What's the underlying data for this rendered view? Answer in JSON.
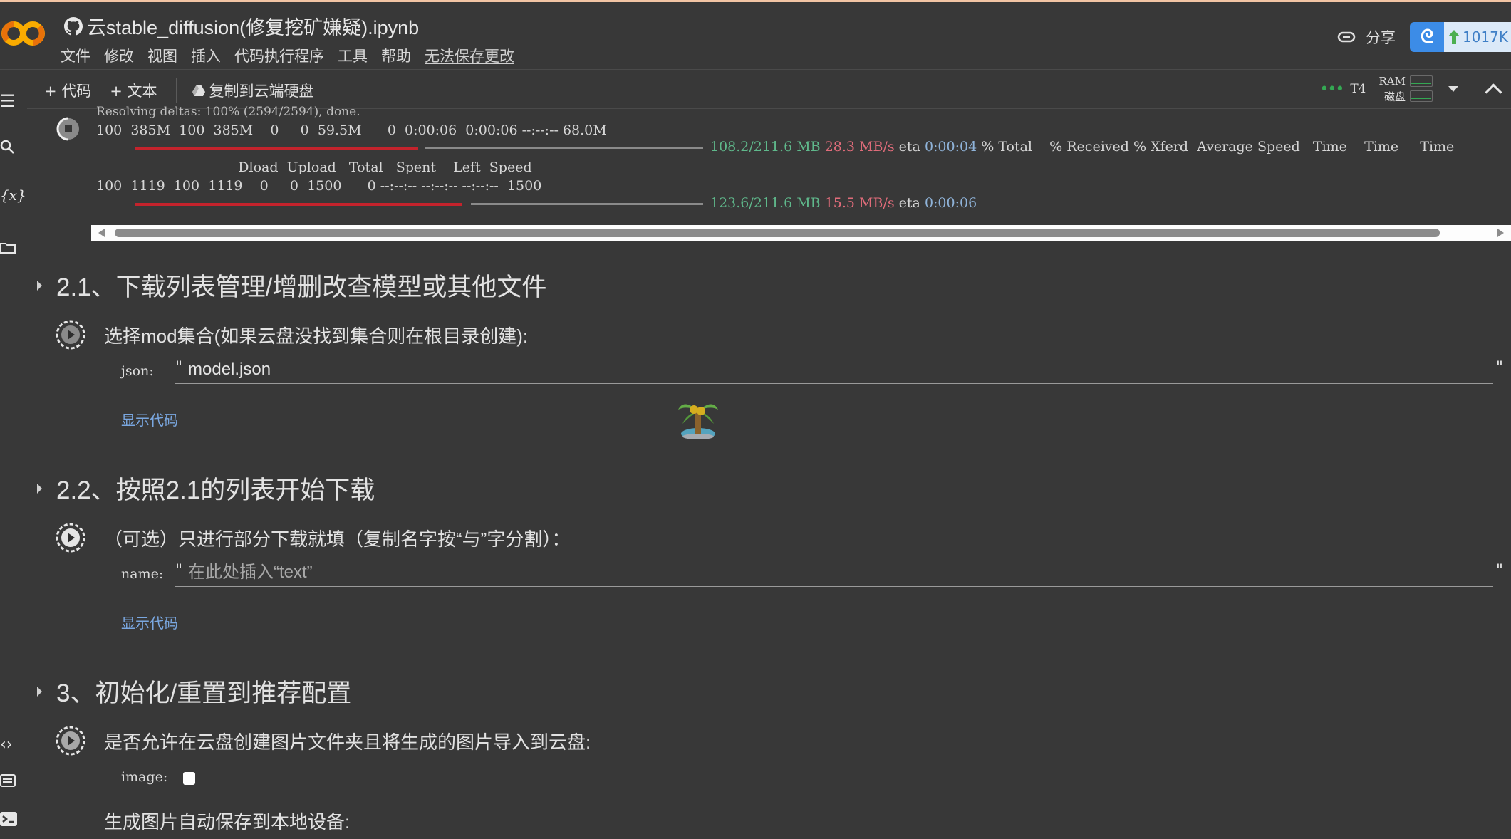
{
  "app": {
    "logo": "colab-logo",
    "title": "云stable_diffusion(修复挖矿嫌疑).ipynb",
    "title_icon": "github-icon"
  },
  "menu": [
    "文件",
    "修改",
    "视图",
    "插入",
    "代码执行程序",
    "工具",
    "帮助"
  ],
  "unsaved_label": "无法保存更改",
  "header_right": {
    "share_label": "分享",
    "share_icon": "link-icon",
    "extension_icon": "cloud-drive-icon",
    "upload_speed": "1017K"
  },
  "toolbar": {
    "add_code": "+ 代码",
    "add_text": "+ 文本",
    "copy_to_drive": "复制到云端硬盘",
    "runtime_name": "T4",
    "ram_label": "RAM",
    "disk_label": "磁盘"
  },
  "rail_icons": [
    "table-of-contents-icon",
    "search-icon",
    "variables-icon",
    "files-icon",
    "code-snippets-icon",
    "command-palette-icon",
    "terminal-icon"
  ],
  "output": {
    "line0": "Resolving deltas: 100% (2594/2594), done.",
    "line1": "100  385M  100  385M    0     0  59.5M      0  0:00:06  0:00:06 --:--:-- 68.0M",
    "progress1": {
      "size": "108.2/211.6 MB",
      "speed": "28.3 MB/s",
      "eta_label": "eta",
      "eta": "0:00:04",
      "trailing": "% Total    % Received % Xferd  Average Speed   Time    Time     Time",
      "fraction": 0.511
    },
    "line2": "                                 Dload  Upload   Total   Spent    Left  Speed",
    "line3": "100  1119  100  1119    0     0  1500      0 --:--:-- --:--:-- --:--:--  1500",
    "progress2": {
      "size": "123.6/211.6 MB",
      "speed": "15.5 MB/s",
      "eta_label": "eta",
      "eta": "0:00:06",
      "fraction": 0.584
    }
  },
  "sections": [
    {
      "heading": "2.1、下载列表管理/增删改查模型或其他文件",
      "cell_title": "选择mod集合(如果云盘没找到集合则在根目录创建):",
      "field_label": "json:",
      "field_value": "model.json",
      "field_placeholder": "",
      "show_code": "显示代码"
    },
    {
      "heading": "2.2、按照2.1的列表开始下载",
      "cell_title": "（可选）只进行部分下载就填（复制名字按“与”字分割）：",
      "field_label": "name:",
      "field_value": "",
      "field_placeholder": "在此处插入“text”",
      "show_code": "显示代码"
    },
    {
      "heading": "3、初始化/重置到推荐配置",
      "cell_title": "是否允许在云盘创建图片文件夹且将生成的图片导入到云盘:",
      "field_label": "image:",
      "checkbox_checked": false,
      "subtitle": "生成图片自动保存到本地设备:"
    }
  ],
  "watermark": {
    "icon": "palm-tree-icon"
  },
  "colors": {
    "background": "#383838",
    "link": "#7aa7e0",
    "progress_red": "#c4232c",
    "progress_size": "#5fb88b",
    "progress_speed": "#e06c7a",
    "progress_eta": "#8fb3d9",
    "runtime_ok": "#34a853",
    "extension_blue": "#3c8ce7"
  }
}
